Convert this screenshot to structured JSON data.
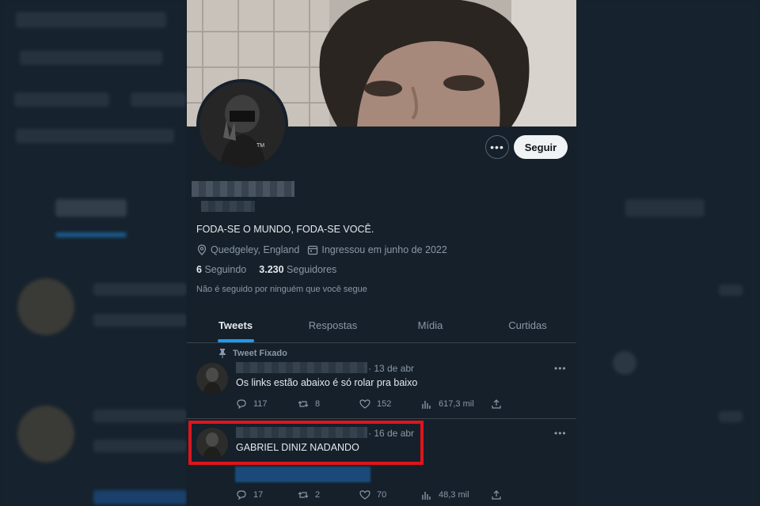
{
  "profile": {
    "more_label": "•••",
    "follow_label": "Seguir",
    "bio": "FODA-SE O MUNDO, FODA-SE VOCÊ.",
    "location": "Quedgeley, England",
    "joined": "Ingressou em junho de 2022",
    "following_count": "6",
    "following_label": "Seguindo",
    "followers_count": "3.230",
    "followers_label": "Seguidores",
    "not_followed": "Não é seguido por ninguém que você segue",
    "avatar_badge": "TM"
  },
  "tabs": [
    "Tweets",
    "Respostas",
    "Mídia",
    "Curtidas"
  ],
  "tweets": [
    {
      "pinned_label": "Tweet Fixado",
      "date": "· 13 de abr",
      "text": "Os links estão abaixo é só rolar pra baixo",
      "replies": "117",
      "retweets": "8",
      "likes": "152",
      "views": "617,3 mil",
      "more": "•••"
    },
    {
      "date": "· 16 de abr",
      "text": "GABRIEL DINIZ NADANDO",
      "replies": "17",
      "retweets": "2",
      "likes": "70",
      "views": "48,3 mil",
      "more": "•••"
    }
  ],
  "colors": {
    "background": "#15202b",
    "accent": "#1d9bf0",
    "highlight_box": "#e0141b",
    "muted_text": "#8b98a5"
  }
}
